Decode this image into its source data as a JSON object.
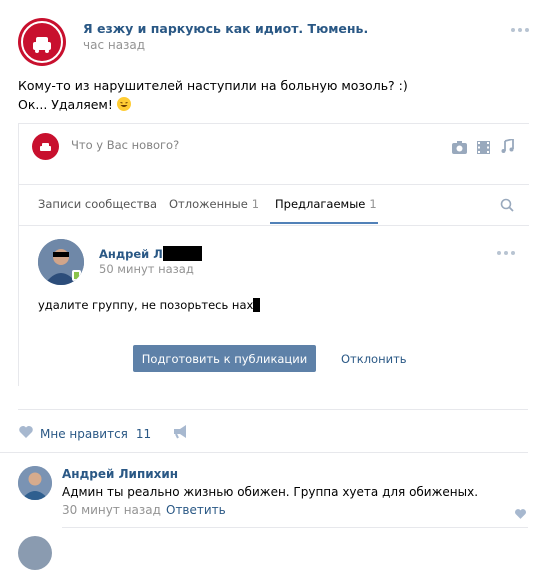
{
  "post": {
    "group_name": "Я езжу и паркуюсь как идиот. Тюмень.",
    "time": "час назад",
    "avatar_text": "Я ЕЗЖУ И ПАРКУЮСЬ КАК ИДИОТ ТЮМЕНЬ",
    "text_line1": "Кому-то из нарушителей наступили на больную мозоль? :)",
    "text_line2": "Ок... Удаляем!"
  },
  "embedded": {
    "placeholder": "Что у Вас нового?",
    "tabs": [
      {
        "label": "Записи сообщества",
        "count": ""
      },
      {
        "label": "Отложенные",
        "count": "1"
      },
      {
        "label": "Предлагаемые",
        "count": "1"
      }
    ],
    "suggested": {
      "author": "Андрей Л",
      "time": "50 минут назад",
      "text": "удалите группу, не позорьтесь нах"
    },
    "publish_label": "Подготовить к публикации",
    "reject_label": "Отклонить"
  },
  "likes": {
    "label": "Мне нравится",
    "count": "11"
  },
  "comment": {
    "author": "Андрей Липихин",
    "text": "Админ ты реально жизнью обижен. Группа хуета для обиженых.",
    "time": "30 минут назад",
    "reply_label": "Ответить"
  },
  "colors": {
    "link": "#2a5885",
    "button": "#5e81a8",
    "brand_red": "#c8102e",
    "tab_accent": "#5181b8"
  }
}
